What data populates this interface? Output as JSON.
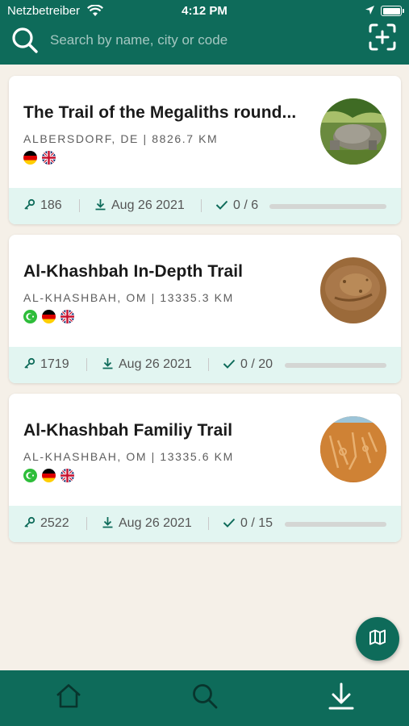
{
  "status_bar": {
    "carrier": "Netzbetreiber",
    "time": "4:12 PM"
  },
  "search": {
    "placeholder": "Search by name, city or code",
    "icon": "search-icon",
    "scan_icon": "scan-add-icon"
  },
  "colors": {
    "primary": "#0e6b5a",
    "footer_bg": "#e2f5f1",
    "background": "#f5f0e8"
  },
  "trails": [
    {
      "title": "The Trail of the Megaliths round...",
      "location": "ALBERSDORF, DE | 8826.7 KM",
      "languages": [
        "german-flag-icon",
        "uk-flag-icon"
      ],
      "code": "186",
      "date": "Aug 26 2021",
      "progress_text": "0 / 6",
      "progress": 0
    },
    {
      "title": "Al-Khashbah In-Depth Trail",
      "location": "AL-KHASHBAH, OM | 13335.3 KM",
      "languages": [
        "arabic-language-icon",
        "german-flag-icon",
        "uk-flag-icon"
      ],
      "code": "1719",
      "date": "Aug 26 2021",
      "progress_text": "0 / 20",
      "progress": 0
    },
    {
      "title": "Al-Khashbah Familiy Trail",
      "location": "AL-KHASHBAH, OM | 13335.6 KM",
      "languages": [
        "arabic-language-icon",
        "german-flag-icon",
        "uk-flag-icon"
      ],
      "code": "2522",
      "date": "Aug 26 2021",
      "progress_text": "0 / 15",
      "progress": 0
    }
  ],
  "fab": {
    "icon": "map-icon"
  },
  "tabbar": {
    "items": [
      "home-icon",
      "search-icon",
      "download-icon"
    ]
  }
}
